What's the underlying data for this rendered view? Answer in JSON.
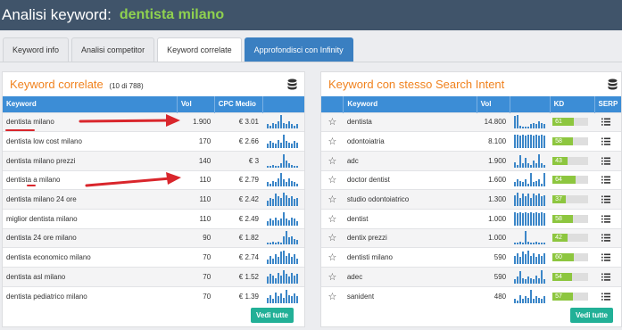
{
  "header": {
    "label": "Analisi keyword:",
    "keyword": "dentista milano"
  },
  "tabs": [
    {
      "label": "Keyword info"
    },
    {
      "label": "Analisi competitor"
    },
    {
      "label": "Keyword correlate"
    },
    {
      "label": "Approfondisci con Infinity"
    }
  ],
  "left_panel": {
    "title": "Keyword correlate",
    "count": "(10 di 788)",
    "columns": [
      "Keyword",
      "Vol",
      "CPC Medio",
      ""
    ],
    "rows": [
      {
        "keyword": "dentista milano",
        "vol": "1.900",
        "cpc": "€ 3.01",
        "trend": [
          0.3,
          0.2,
          0.4,
          0.3,
          0.5,
          1,
          0.4,
          0.3,
          0.5,
          0.3,
          0.2,
          0.3
        ]
      },
      {
        "keyword": "dentista low cost milano",
        "vol": "170",
        "cpc": "€ 2.66",
        "trend": [
          0.3,
          0.5,
          0.4,
          0.3,
          0.6,
          0.4,
          1,
          0.5,
          0.4,
          0.3,
          0.5,
          0.4
        ]
      },
      {
        "keyword": "dentista milano prezzi",
        "vol": "140",
        "cpc": "€ 3",
        "trend": [
          0.1,
          0.1,
          0.2,
          0.1,
          0.1,
          0.3,
          1,
          0.5,
          0.3,
          0.2,
          0.1,
          0.1
        ]
      },
      {
        "keyword": "dentista a milano",
        "vol": "110",
        "cpc": "€ 2.79",
        "trend": [
          0.3,
          0.2,
          0.4,
          0.3,
          0.6,
          1,
          0.5,
          0.3,
          0.6,
          0.4,
          0.3,
          0.2
        ]
      },
      {
        "keyword": "dentista milano 24 ore",
        "vol": "110",
        "cpc": "€ 2.42",
        "trend": [
          0.4,
          0.6,
          0.5,
          0.9,
          0.7,
          0.6,
          1,
          0.8,
          0.6,
          0.7,
          0.5,
          0.6
        ]
      },
      {
        "keyword": "miglior dentista milano",
        "vol": "110",
        "cpc": "€ 2.49",
        "trend": [
          0.3,
          0.5,
          0.4,
          0.6,
          0.4,
          0.5,
          1,
          0.5,
          0.4,
          0.6,
          0.5,
          0.3
        ]
      },
      {
        "keyword": "dentista 24 ore milano",
        "vol": "90",
        "cpc": "€ 1.82",
        "trend": [
          0.1,
          0.1,
          0.2,
          0.1,
          0.2,
          0.1,
          0.6,
          1,
          0.5,
          0.6,
          0.4,
          0.3
        ]
      },
      {
        "keyword": "dentista economico milano",
        "vol": "70",
        "cpc": "€ 2.74",
        "trend": [
          0.3,
          0.6,
          0.4,
          0.7,
          0.5,
          0.9,
          1,
          0.6,
          0.8,
          0.5,
          0.7,
          0.4
        ]
      },
      {
        "keyword": "dentista asl milano",
        "vol": "70",
        "cpc": "€ 1.52",
        "trend": [
          0.5,
          0.7,
          0.6,
          0.4,
          0.8,
          0.6,
          1,
          0.7,
          0.5,
          0.8,
          0.6,
          0.7
        ]
      },
      {
        "keyword": "dentista pediatrico milano",
        "vol": "70",
        "cpc": "€ 1.39",
        "trend": [
          0.4,
          0.6,
          0.3,
          0.8,
          0.5,
          0.7,
          0.4,
          1,
          0.6,
          0.5,
          0.7,
          0.5
        ]
      }
    ],
    "button": "Vedi tutte"
  },
  "right_panel": {
    "title": "Keyword con stesso Search Intent",
    "columns": [
      "",
      "Keyword",
      "Vol",
      "",
      "KD",
      "SERP"
    ],
    "rows": [
      {
        "keyword": "dentista",
        "vol": "14.800",
        "kd": "61",
        "trend": [
          0.9,
          1,
          0.2,
          0.1,
          0.1,
          0.1,
          0.3,
          0.4,
          0.3,
          0.5,
          0.4,
          0.3
        ]
      },
      {
        "keyword": "odontoiatria",
        "vol": "8.100",
        "kd": "58",
        "trend": [
          1,
          1,
          0.9,
          1,
          0.9,
          1,
          1,
          0.9,
          1,
          0.9,
          1,
          0.9
        ]
      },
      {
        "keyword": "adc",
        "vol": "1.900",
        "kd": "43",
        "trend": [
          0.4,
          0.2,
          0.9,
          0.3,
          0.7,
          0.3,
          0.2,
          0.5,
          0.3,
          1,
          0.3,
          0.2
        ]
      },
      {
        "keyword": "doctor dentist",
        "vol": "1.600",
        "kd": "64",
        "trend": [
          0.3,
          0.5,
          0.4,
          0.3,
          0.5,
          0.2,
          1,
          0.3,
          0.4,
          0.5,
          0.2,
          1
        ]
      },
      {
        "keyword": "studio odontoiatrico",
        "vol": "1.300",
        "kd": "37",
        "trend": [
          0.8,
          1,
          0.6,
          0.9,
          0.7,
          0.9,
          0.6,
          0.9,
          0.8,
          0.9,
          0.7,
          0.8
        ]
      },
      {
        "keyword": "dentist",
        "vol": "1.000",
        "kd": "58",
        "trend": [
          1,
          0.9,
          1,
          0.9,
          1,
          0.9,
          1,
          0.9,
          1,
          0.9,
          1,
          0.9
        ]
      },
      {
        "keyword": "dentix prezzi",
        "vol": "1.000",
        "kd": "42",
        "trend": [
          0.1,
          0.1,
          0.2,
          0.1,
          1,
          0.2,
          0.1,
          0.1,
          0.2,
          0.1,
          0.1,
          0.1
        ]
      },
      {
        "keyword": "dentisti milano",
        "vol": "590",
        "kd": "60",
        "trend": [
          0.6,
          0.8,
          0.5,
          0.9,
          0.7,
          1,
          0.6,
          0.8,
          0.5,
          0.7,
          0.6,
          0.8
        ]
      },
      {
        "keyword": "adec",
        "vol": "590",
        "kd": "54",
        "trend": [
          0.3,
          0.5,
          0.9,
          0.4,
          0.3,
          0.5,
          0.4,
          0.3,
          0.6,
          0.4,
          1,
          0.3
        ]
      },
      {
        "keyword": "sanident",
        "vol": "480",
        "kd": "57",
        "trend": [
          0.3,
          0.2,
          0.6,
          0.3,
          0.5,
          0.4,
          1,
          0.3,
          0.5,
          0.4,
          0.3,
          0.5
        ]
      }
    ],
    "button": "Vedi tutte"
  },
  "colors": {
    "accent_orange": "#f0821e",
    "header_blue": "#3c8dd6",
    "kd_green": "#8dc63f",
    "button_teal": "#22b097",
    "annotation_red": "#d9262c"
  }
}
